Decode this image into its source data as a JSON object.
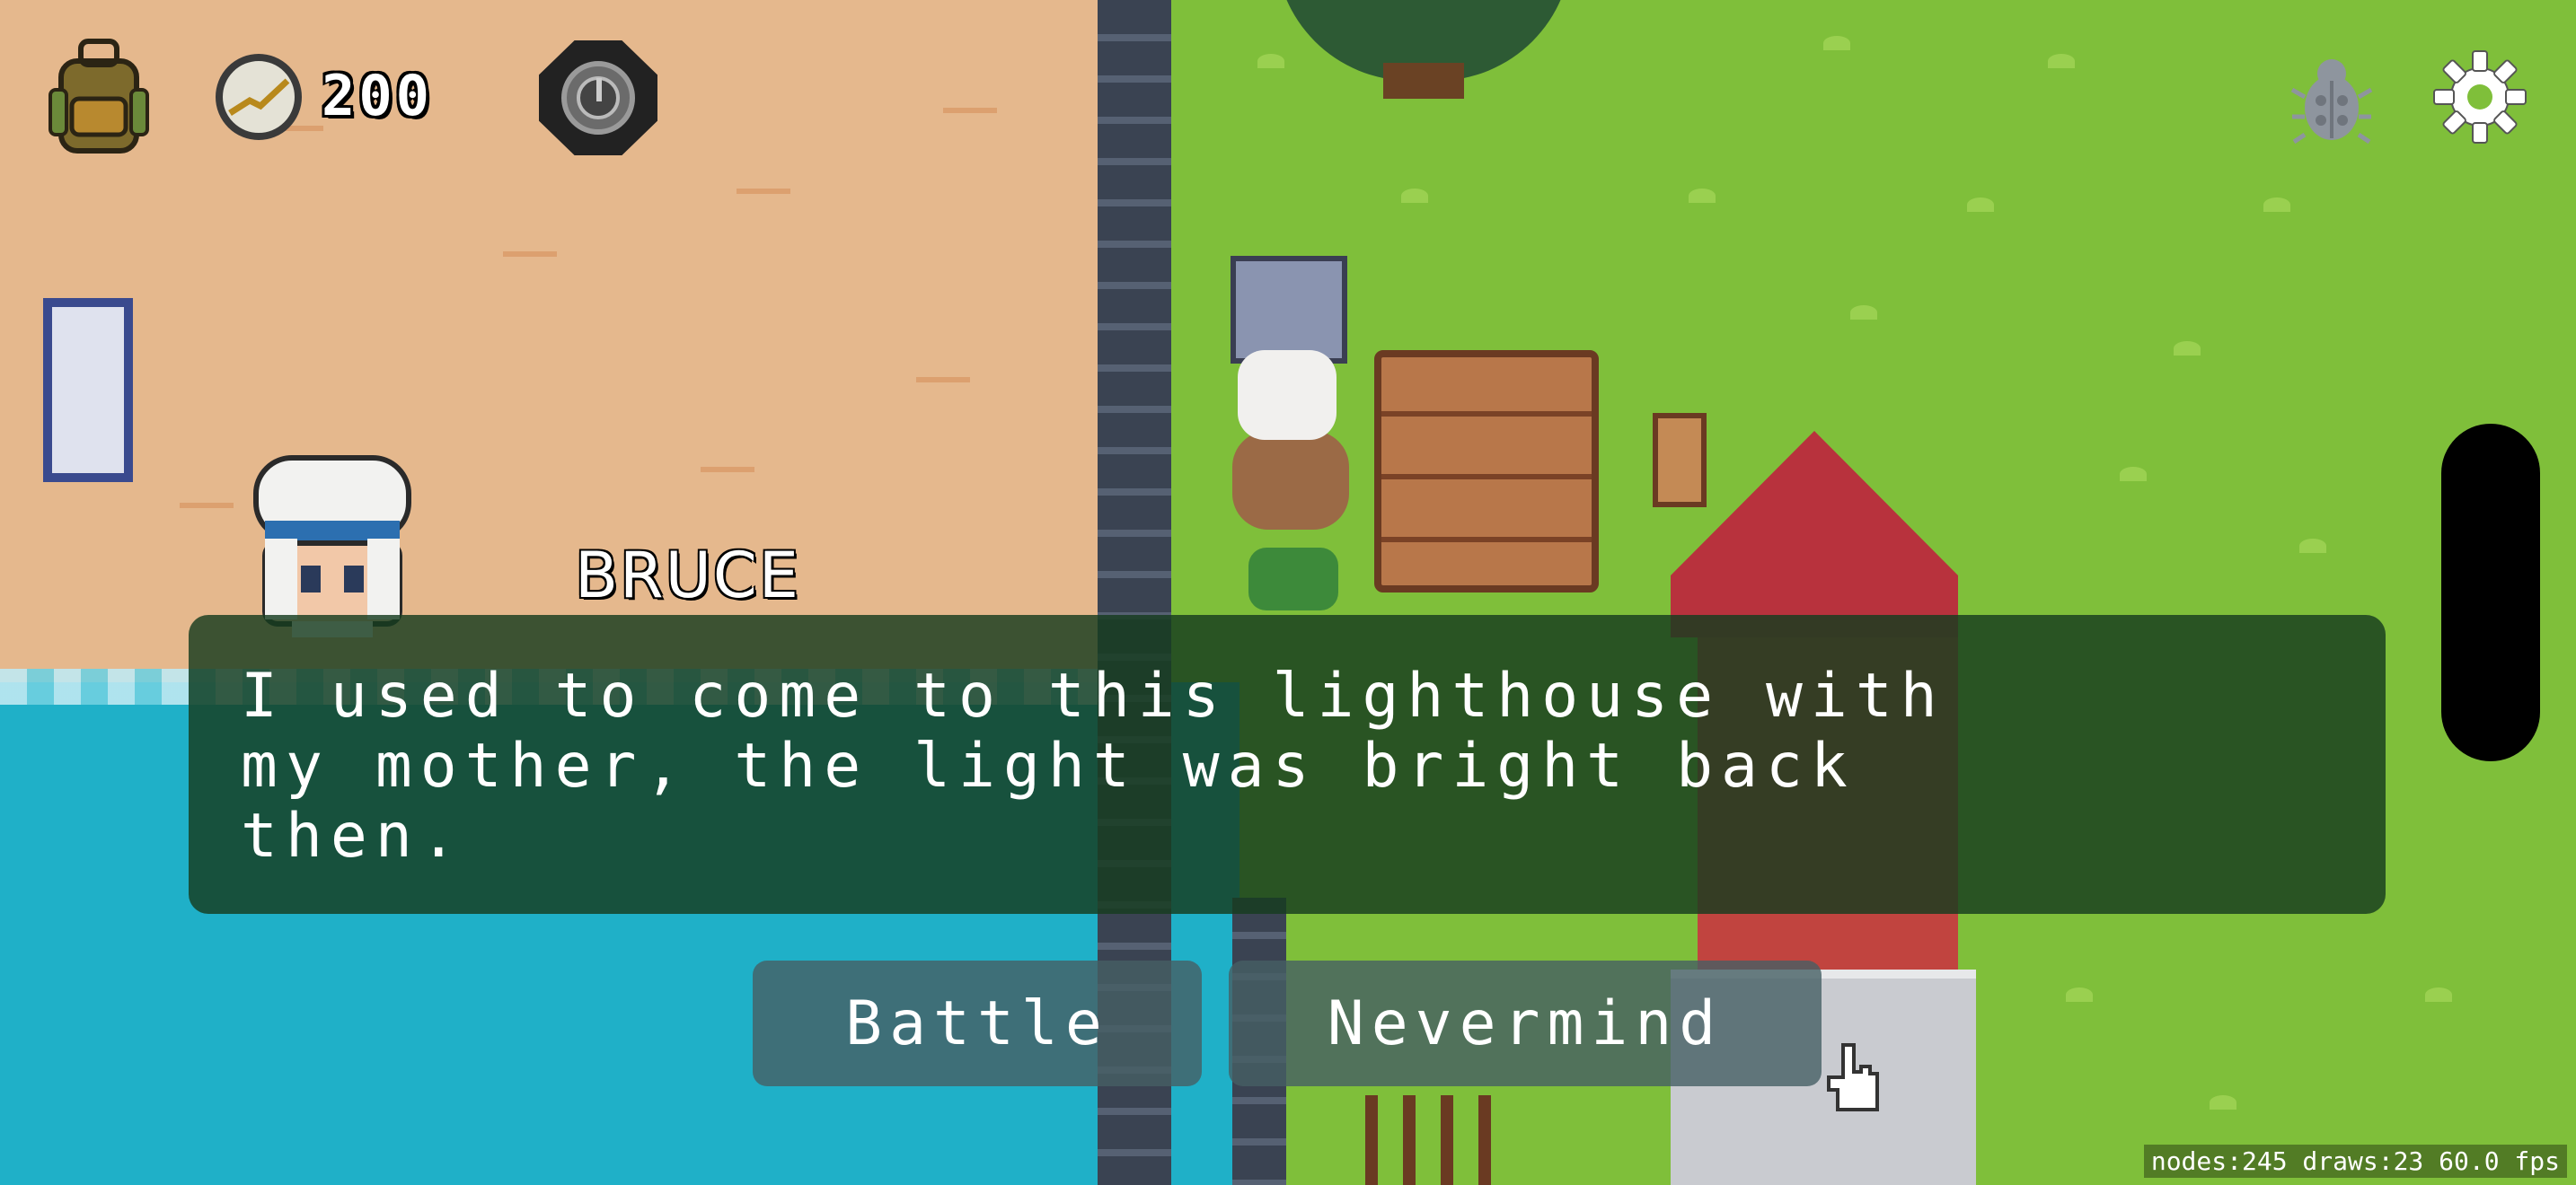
{
  "hud": {
    "coins": "200"
  },
  "dialog": {
    "speaker": "BRUCE",
    "text": "I used to come to this lighthouse with\nmy mother, the light was bright back\nthen."
  },
  "choices": {
    "battle": "Battle",
    "nevermind": "Nevermind"
  },
  "debug": {
    "stats": "nodes:245 draws:23  60.0 fps"
  },
  "icons": {
    "backpack": "backpack-icon",
    "coin": "coin-icon",
    "badge": "badge-icon",
    "bug": "bug-icon",
    "settings": "gear-icon"
  }
}
